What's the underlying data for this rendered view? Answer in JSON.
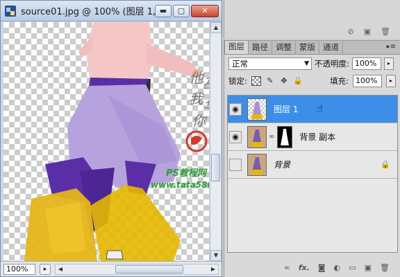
{
  "document": {
    "title": "source01.jpg @ 100% (图层 1, RG...",
    "window_buttons": {
      "minimize": "▬",
      "maximize": "▢",
      "close": "✕"
    },
    "zoom": "100%",
    "watermark_lines": [
      "他",
      "巫",
      "我",
      "华",
      "你"
    ],
    "watermark_ps": "PS教程网",
    "watermark_url": "www.tata580.com"
  },
  "layers_panel": {
    "tabs": [
      "图层",
      "路径",
      "调整",
      "蒙版",
      "通道"
    ],
    "active_tab": "图层",
    "menu_icon": "▸≡",
    "blend_mode": "正常",
    "opacity_label": "不透明度:",
    "opacity_value": "100%",
    "lock_label": "锁定:",
    "fill_label": "填充:",
    "fill_value": "100%",
    "layers": [
      {
        "name": "图层 1",
        "visible": true,
        "selected": true
      },
      {
        "name": "背景 副本",
        "visible": true,
        "selected": false
      },
      {
        "name": "背景",
        "visible": false,
        "selected": false
      }
    ],
    "bottom_icons": [
      "link-icon",
      "fx-icon",
      "mask-icon",
      "adjustment-icon",
      "folder-icon",
      "new-layer-icon",
      "trash-icon"
    ]
  },
  "icon_glyphs": {
    "eye": "◉",
    "lock": "🔒",
    "brush": "✎",
    "move": "✥",
    "hand": "☝",
    "chain": "∞",
    "caret": "▼",
    "right_arrow": "▸",
    "up": "▲",
    "down": "▼",
    "left": "◀",
    "right": "▶"
  },
  "colors": {
    "selection": "#3d8ee8",
    "skirt": "#b39ddb",
    "yellow": "#e6b800",
    "purple": "#5a2ea6",
    "pink_top": "#f6c6c8"
  }
}
